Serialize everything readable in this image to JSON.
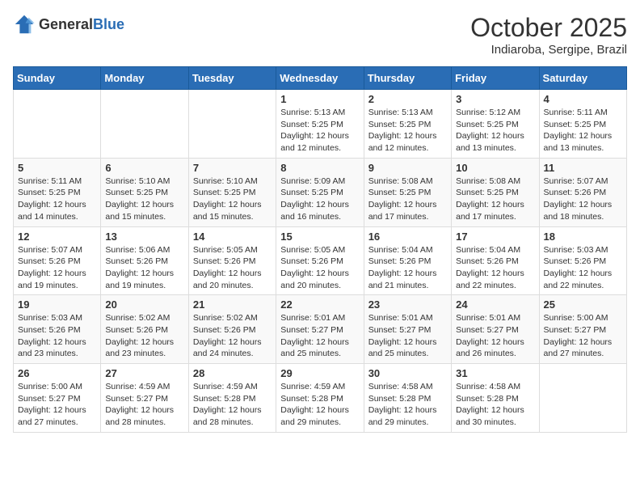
{
  "logo": {
    "general": "General",
    "blue": "Blue"
  },
  "header": {
    "month": "October 2025",
    "location": "Indiaroba, Sergipe, Brazil"
  },
  "days_of_week": [
    "Sunday",
    "Monday",
    "Tuesday",
    "Wednesday",
    "Thursday",
    "Friday",
    "Saturday"
  ],
  "weeks": [
    [
      {
        "day": "",
        "sunrise": "",
        "sunset": "",
        "daylight": ""
      },
      {
        "day": "",
        "sunrise": "",
        "sunset": "",
        "daylight": ""
      },
      {
        "day": "",
        "sunrise": "",
        "sunset": "",
        "daylight": ""
      },
      {
        "day": "1",
        "sunrise": "Sunrise: 5:13 AM",
        "sunset": "Sunset: 5:25 PM",
        "daylight": "Daylight: 12 hours and 12 minutes."
      },
      {
        "day": "2",
        "sunrise": "Sunrise: 5:13 AM",
        "sunset": "Sunset: 5:25 PM",
        "daylight": "Daylight: 12 hours and 12 minutes."
      },
      {
        "day": "3",
        "sunrise": "Sunrise: 5:12 AM",
        "sunset": "Sunset: 5:25 PM",
        "daylight": "Daylight: 12 hours and 13 minutes."
      },
      {
        "day": "4",
        "sunrise": "Sunrise: 5:11 AM",
        "sunset": "Sunset: 5:25 PM",
        "daylight": "Daylight: 12 hours and 13 minutes."
      }
    ],
    [
      {
        "day": "5",
        "sunrise": "Sunrise: 5:11 AM",
        "sunset": "Sunset: 5:25 PM",
        "daylight": "Daylight: 12 hours and 14 minutes."
      },
      {
        "day": "6",
        "sunrise": "Sunrise: 5:10 AM",
        "sunset": "Sunset: 5:25 PM",
        "daylight": "Daylight: 12 hours and 15 minutes."
      },
      {
        "day": "7",
        "sunrise": "Sunrise: 5:10 AM",
        "sunset": "Sunset: 5:25 PM",
        "daylight": "Daylight: 12 hours and 15 minutes."
      },
      {
        "day": "8",
        "sunrise": "Sunrise: 5:09 AM",
        "sunset": "Sunset: 5:25 PM",
        "daylight": "Daylight: 12 hours and 16 minutes."
      },
      {
        "day": "9",
        "sunrise": "Sunrise: 5:08 AM",
        "sunset": "Sunset: 5:25 PM",
        "daylight": "Daylight: 12 hours and 17 minutes."
      },
      {
        "day": "10",
        "sunrise": "Sunrise: 5:08 AM",
        "sunset": "Sunset: 5:25 PM",
        "daylight": "Daylight: 12 hours and 17 minutes."
      },
      {
        "day": "11",
        "sunrise": "Sunrise: 5:07 AM",
        "sunset": "Sunset: 5:26 PM",
        "daylight": "Daylight: 12 hours and 18 minutes."
      }
    ],
    [
      {
        "day": "12",
        "sunrise": "Sunrise: 5:07 AM",
        "sunset": "Sunset: 5:26 PM",
        "daylight": "Daylight: 12 hours and 19 minutes."
      },
      {
        "day": "13",
        "sunrise": "Sunrise: 5:06 AM",
        "sunset": "Sunset: 5:26 PM",
        "daylight": "Daylight: 12 hours and 19 minutes."
      },
      {
        "day": "14",
        "sunrise": "Sunrise: 5:05 AM",
        "sunset": "Sunset: 5:26 PM",
        "daylight": "Daylight: 12 hours and 20 minutes."
      },
      {
        "day": "15",
        "sunrise": "Sunrise: 5:05 AM",
        "sunset": "Sunset: 5:26 PM",
        "daylight": "Daylight: 12 hours and 20 minutes."
      },
      {
        "day": "16",
        "sunrise": "Sunrise: 5:04 AM",
        "sunset": "Sunset: 5:26 PM",
        "daylight": "Daylight: 12 hours and 21 minutes."
      },
      {
        "day": "17",
        "sunrise": "Sunrise: 5:04 AM",
        "sunset": "Sunset: 5:26 PM",
        "daylight": "Daylight: 12 hours and 22 minutes."
      },
      {
        "day": "18",
        "sunrise": "Sunrise: 5:03 AM",
        "sunset": "Sunset: 5:26 PM",
        "daylight": "Daylight: 12 hours and 22 minutes."
      }
    ],
    [
      {
        "day": "19",
        "sunrise": "Sunrise: 5:03 AM",
        "sunset": "Sunset: 5:26 PM",
        "daylight": "Daylight: 12 hours and 23 minutes."
      },
      {
        "day": "20",
        "sunrise": "Sunrise: 5:02 AM",
        "sunset": "Sunset: 5:26 PM",
        "daylight": "Daylight: 12 hours and 23 minutes."
      },
      {
        "day": "21",
        "sunrise": "Sunrise: 5:02 AM",
        "sunset": "Sunset: 5:26 PM",
        "daylight": "Daylight: 12 hours and 24 minutes."
      },
      {
        "day": "22",
        "sunrise": "Sunrise: 5:01 AM",
        "sunset": "Sunset: 5:27 PM",
        "daylight": "Daylight: 12 hours and 25 minutes."
      },
      {
        "day": "23",
        "sunrise": "Sunrise: 5:01 AM",
        "sunset": "Sunset: 5:27 PM",
        "daylight": "Daylight: 12 hours and 25 minutes."
      },
      {
        "day": "24",
        "sunrise": "Sunrise: 5:01 AM",
        "sunset": "Sunset: 5:27 PM",
        "daylight": "Daylight: 12 hours and 26 minutes."
      },
      {
        "day": "25",
        "sunrise": "Sunrise: 5:00 AM",
        "sunset": "Sunset: 5:27 PM",
        "daylight": "Daylight: 12 hours and 27 minutes."
      }
    ],
    [
      {
        "day": "26",
        "sunrise": "Sunrise: 5:00 AM",
        "sunset": "Sunset: 5:27 PM",
        "daylight": "Daylight: 12 hours and 27 minutes."
      },
      {
        "day": "27",
        "sunrise": "Sunrise: 4:59 AM",
        "sunset": "Sunset: 5:27 PM",
        "daylight": "Daylight: 12 hours and 28 minutes."
      },
      {
        "day": "28",
        "sunrise": "Sunrise: 4:59 AM",
        "sunset": "Sunset: 5:28 PM",
        "daylight": "Daylight: 12 hours and 28 minutes."
      },
      {
        "day": "29",
        "sunrise": "Sunrise: 4:59 AM",
        "sunset": "Sunset: 5:28 PM",
        "daylight": "Daylight: 12 hours and 29 minutes."
      },
      {
        "day": "30",
        "sunrise": "Sunrise: 4:58 AM",
        "sunset": "Sunset: 5:28 PM",
        "daylight": "Daylight: 12 hours and 29 minutes."
      },
      {
        "day": "31",
        "sunrise": "Sunrise: 4:58 AM",
        "sunset": "Sunset: 5:28 PM",
        "daylight": "Daylight: 12 hours and 30 minutes."
      },
      {
        "day": "",
        "sunrise": "",
        "sunset": "",
        "daylight": ""
      }
    ]
  ]
}
